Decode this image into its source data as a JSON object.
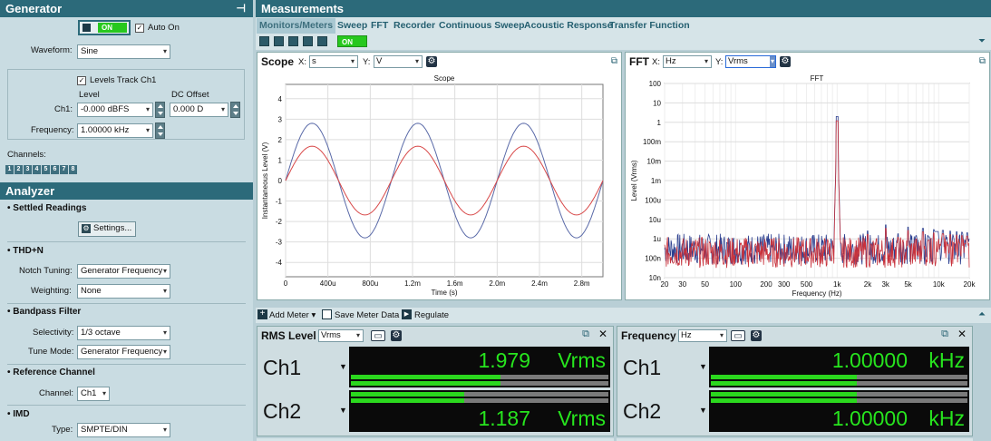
{
  "generator": {
    "title": "Generator",
    "on_label": "ON",
    "auto_on_label": "Auto On",
    "waveform_label": "Waveform:",
    "waveform_value": "Sine",
    "levels_track_label": "Levels Track Ch1",
    "level_col": "Level",
    "dc_offset_col": "DC Offset",
    "ch1_label": "Ch1:",
    "ch1_level": "-0.000 dBFS",
    "ch1_dc": "0.000 D",
    "frequency_label": "Frequency:",
    "frequency_value": "1.00000 kHz",
    "channels_label": "Channels:",
    "channels": [
      "1",
      "2",
      "3",
      "4",
      "5",
      "6",
      "7",
      "8"
    ]
  },
  "analyzer": {
    "title": "Analyzer",
    "settled_title": "• Settled Readings",
    "settings_button": "Settings...",
    "thd_title": "• THD+N",
    "notch_label": "Notch Tuning:",
    "notch_value": "Generator Frequency",
    "weighting_label": "Weighting:",
    "weighting_value": "None",
    "bandpass_title": "• Bandpass Filter",
    "selectivity_label": "Selectivity:",
    "selectivity_value": "1/3 octave",
    "tunemode_label": "Tune Mode:",
    "tunemode_value": "Generator Frequency",
    "refch_title": "• Reference Channel",
    "channel_label": "Channel:",
    "channel_value": "Ch1",
    "imd_title": "• IMD",
    "type_label": "Type:",
    "type_value": "SMPTE/DIN"
  },
  "measurements": {
    "title": "Measurements",
    "tabs": [
      "Monitors/Meters",
      "Sweep",
      "FFT",
      "Recorder",
      "Continuous Sweep",
      "Acoustic Response",
      "Transfer Function"
    ],
    "on_label": "ON"
  },
  "scope": {
    "title": "Scope",
    "x_label": "X:",
    "x_value": "s",
    "y_label": "Y:",
    "y_value": "V",
    "chart_title": "Scope",
    "ylabel": "Instantaneous Level (V)",
    "xlabel": "Time (s)",
    "yticks": [
      "4",
      "3",
      "2",
      "1",
      "0",
      "-1",
      "-2",
      "-3",
      "-4"
    ],
    "xticks": [
      "0",
      "400u",
      "800u",
      "1.2m",
      "1.6m",
      "2.0m",
      "2.4m",
      "2.8m"
    ]
  },
  "fft": {
    "title": "FFT",
    "x_label": "X:",
    "x_value": "Hz",
    "y_label": "Y:",
    "y_value": "Vrms",
    "chart_title": "FFT",
    "ylabel": "Level (Vrms)",
    "xlabel": "Frequency (Hz)",
    "yticks": [
      "100",
      "10",
      "1",
      "100m",
      "10m",
      "1m",
      "100u",
      "10u",
      "1u",
      "100n",
      "10n"
    ],
    "xticks": [
      "20",
      "30",
      "50",
      "100",
      "200",
      "300",
      "500",
      "1k",
      "2k",
      "3k",
      "5k",
      "10k",
      "20k"
    ]
  },
  "meter_toolbar": {
    "add_meter": "Add Meter",
    "save_meter": "Save Meter Data",
    "regulate": "Regulate"
  },
  "rms": {
    "title": "RMS Level",
    "unit_sel": "Vrms",
    "ch1_name": "Ch1",
    "ch1_value": "1.979",
    "ch1_unit": "Vrms",
    "ch1_fill": 0.58,
    "ch2_name": "Ch2",
    "ch2_value": "1.187",
    "ch2_unit": "Vrms",
    "ch2_fill": 0.44
  },
  "freq": {
    "title": "Frequency",
    "unit_sel": "Hz",
    "ch1_name": "Ch1",
    "ch1_value": "1.00000",
    "ch1_unit": "kHz",
    "ch1_fill": 0.57,
    "ch2_name": "Ch2",
    "ch2_value": "1.00000",
    "ch2_unit": "kHz",
    "ch2_fill": 0.57
  },
  "chart_data": [
    {
      "type": "line",
      "title": "Scope",
      "xlabel": "Time (s)",
      "ylabel": "Instantaneous Level (V)",
      "xlim": [
        0,
        0.003
      ],
      "ylim": [
        -4.7,
        4.7
      ],
      "grid": true,
      "series": [
        {
          "color": "#5a6aa8",
          "amplitude": 2.8,
          "frequency_hz": 1000
        },
        {
          "color": "#d84848",
          "amplitude": 1.68,
          "frequency_hz": 1000
        }
      ]
    },
    {
      "type": "line",
      "title": "FFT",
      "xlabel": "Frequency (Hz)",
      "ylabel": "Level (Vrms)",
      "xscale": "log",
      "yscale": "log",
      "xlim": [
        20,
        20000
      ],
      "ylim": [
        1e-08,
        100
      ],
      "grid": true,
      "series": [
        {
          "color": "#2c3f8f",
          "peak_x": 1000,
          "peak_y": 2.0,
          "noise_floor": 3e-07
        },
        {
          "color": "#c8323c",
          "peak_x": 1000,
          "peak_y": 1.2,
          "noise_floor": 2e-07
        }
      ]
    }
  ]
}
